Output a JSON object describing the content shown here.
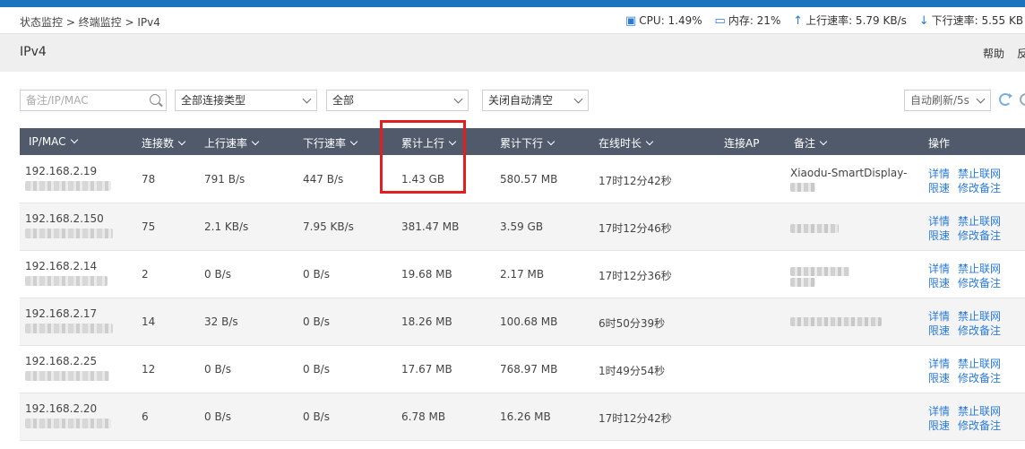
{
  "breadcrumb": "状态监控 > 终端监控 > IPv4",
  "stats": {
    "cpu": "CPU: 1.49%",
    "memory": "内存: 21%",
    "upload": "上行速率: 5.79 KB/s",
    "download": "下行速率: 5.55 KB"
  },
  "page": {
    "title": "IPv4",
    "help_label": "帮助",
    "feedback_label": "反"
  },
  "filters": {
    "search_placeholder": "备注/IP/MAC",
    "conn_type": "全部连接类型",
    "scope": "全部",
    "auto_clear": "关闭自动清空",
    "auto_refresh": "自动刷新/5s"
  },
  "table": {
    "columns": {
      "ipmac": "IP/MAC",
      "conns": "连接数",
      "up": "上行速率",
      "down": "下行速率",
      "total_up": "累计上行",
      "total_down": "累计下行",
      "online": "在线时长",
      "ap": "连接AP",
      "note": "备注",
      "ops": "操作"
    },
    "actions": {
      "detail": "详情",
      "block": "禁止联网",
      "limit": "限速",
      "edit_note": "修改备注"
    },
    "rows": [
      {
        "ip": "192.168.2.19",
        "conns": "78",
        "up": "791 B/s",
        "down": "447 B/s",
        "total_up": "1.43 GB",
        "total_down": "580.57 MB",
        "online": "17时12分42秒",
        "note": "Xiaodu-SmartDisplay-"
      },
      {
        "ip": "192.168.2.150",
        "conns": "75",
        "up": "2.1 KB/s",
        "down": "7.95 KB/s",
        "total_up": "381.47 MB",
        "total_down": "3.59 GB",
        "online": "17时12分46秒",
        "note": ""
      },
      {
        "ip": "192.168.2.14",
        "conns": "2",
        "up": "0 B/s",
        "down": "0 B/s",
        "total_up": "19.68 MB",
        "total_down": "2.17 MB",
        "online": "17时12分36秒",
        "note": ""
      },
      {
        "ip": "192.168.2.17",
        "conns": "14",
        "up": "32 B/s",
        "down": "0 B/s",
        "total_up": "18.26 MB",
        "total_down": "100.68 MB",
        "online": "6时50分39秒",
        "note": ""
      },
      {
        "ip": "192.168.2.25",
        "conns": "12",
        "up": "0 B/s",
        "down": "0 B/s",
        "total_up": "17.67 MB",
        "total_down": "768.97 MB",
        "online": "1时49分54秒",
        "note": ""
      },
      {
        "ip": "192.168.2.20",
        "conns": "6",
        "up": "0 B/s",
        "down": "0 B/s",
        "total_up": "6.78 MB",
        "total_down": "16.26 MB",
        "online": "17时12分42秒",
        "note": ""
      }
    ]
  },
  "colors": {
    "accent": "#2a7bd8",
    "header_bg": "#505a6a",
    "highlight": "#e02020"
  }
}
